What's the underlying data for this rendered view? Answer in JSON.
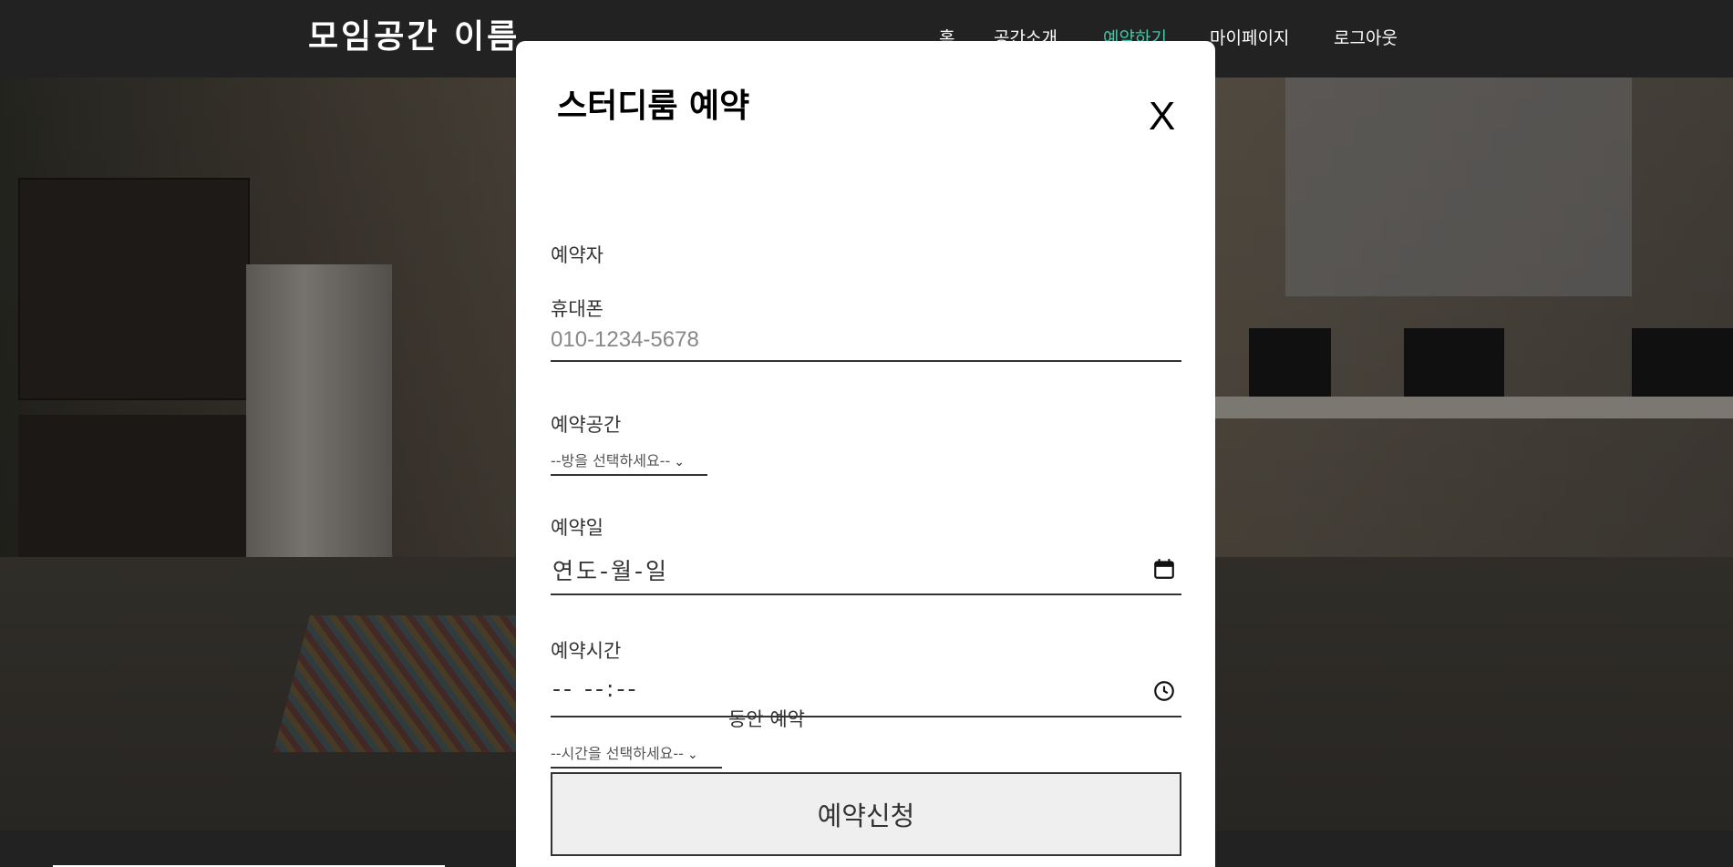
{
  "header": {
    "brand": "모임공간 이름",
    "nav": [
      {
        "label": "홈",
        "active": false
      },
      {
        "label": "공간소개",
        "active": false
      },
      {
        "label": "예약하기",
        "active": true
      },
      {
        "label": "마이페이지",
        "active": false
      },
      {
        "label": "로그아웃",
        "active": false
      }
    ],
    "active_color": "#43c5a6"
  },
  "modal": {
    "title": "스터디룸 예약",
    "close_label": "X",
    "reserver_label": "예약자",
    "phone": {
      "label": "휴대폰",
      "placeholder": "010-1234-5678",
      "value": ""
    },
    "space": {
      "label": "예약공간",
      "selected": "--방을 선택하세요--"
    },
    "date": {
      "label": "예약일",
      "placeholder": "연도-월-일",
      "icon": "calendar-icon"
    },
    "time": {
      "label": "예약시간",
      "placeholder": "-- --:--",
      "icon": "clock-icon"
    },
    "duration": {
      "selected": "--시간을 선택하세요--",
      "suffix": "동안 예약"
    },
    "submit_label": "예약신청"
  }
}
